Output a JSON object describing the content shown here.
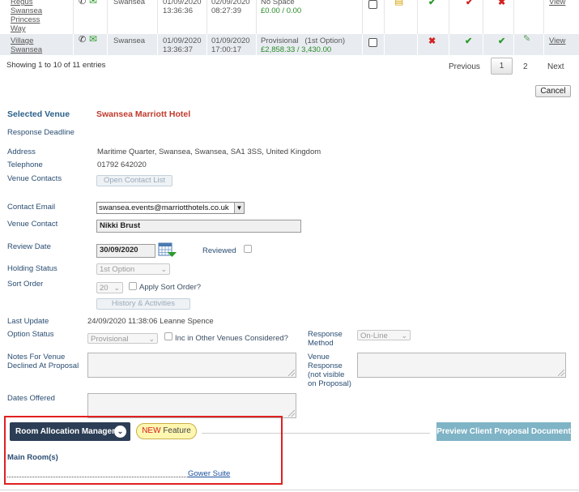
{
  "table": {
    "row1": {
      "name_lines": [
        "Regus",
        "Swansea",
        "Princess",
        "Way"
      ],
      "location": "Swansea",
      "date1": [
        "01/09/2020",
        "13:36:36"
      ],
      "date2": [
        "02/09/2020",
        "08:27:39"
      ],
      "status": "No Space",
      "price": "£0.00 / 0.00",
      "view": "View"
    },
    "row2": {
      "name_lines": [
        "Village",
        "Swansea"
      ],
      "location": "Swansea",
      "date1": [
        "01/09/2020",
        "13:36:37"
      ],
      "date2": [
        "01/09/2020",
        "17:00:17"
      ],
      "status": "Provisional   (1st Option)",
      "price": "£2,858.33 / 3,430.00",
      "view": "View"
    }
  },
  "pagination": {
    "info": "Showing 1 to 10 of 11 entries",
    "previous": "Previous",
    "current": "1",
    "page2": "2",
    "next": "Next"
  },
  "cancel_label": "Cancel",
  "venue": {
    "selected_label": "Selected Venue",
    "selected_name": "Swansea Marriott Hotel",
    "response_deadline_label": "Response Deadline",
    "address_label": "Address",
    "address": "Maritime Quarter, Swansea, Swansea, SA1 3SS, United Kingdom",
    "telephone_label": "Telephone",
    "telephone": "01792 642020",
    "contacts_label": "Venue Contacts",
    "open_contact_list": "Open Contact List",
    "contact_email_label": "Contact Email",
    "contact_email": "swansea.events@marriotthotels.co.uk",
    "venue_contact_label": "Venue Contact",
    "venue_contact": "Nikki Brust",
    "review_date_label": "Review Date",
    "review_date": "30/09/2020",
    "reviewed_label": "Reviewed",
    "holding_status_label": "Holding Status",
    "holding_status": "1st Option",
    "sort_order_label": "Sort Order",
    "sort_order": "20",
    "apply_sort_label": "Apply Sort Order?",
    "history_btn": "History & Activities",
    "last_update_label": "Last Update",
    "last_update": "24/09/2020 11:38:06 Leanne Spence",
    "option_status_label": "Option Status",
    "option_status": "Provisional",
    "inc_other_label": "Inc in Other Venues Considered?",
    "response_method_label": [
      "Response",
      "Method"
    ],
    "response_method": "On-Line",
    "notes_label": [
      "Notes For Venue",
      "Declined At Proposal"
    ],
    "venue_response_label": [
      "Venue",
      "Response",
      "(not visible",
      "on Proposal)"
    ],
    "dates_offered_label": "Dates Offered"
  },
  "room_alloc": {
    "button": "Room Allocation Manager",
    "new_word": "NEW",
    "feature_word": " Feature",
    "preview_btn": "Preview Client Proposal Document",
    "main_rooms": "Main Room(s)",
    "room_link": "Gower Suite"
  }
}
